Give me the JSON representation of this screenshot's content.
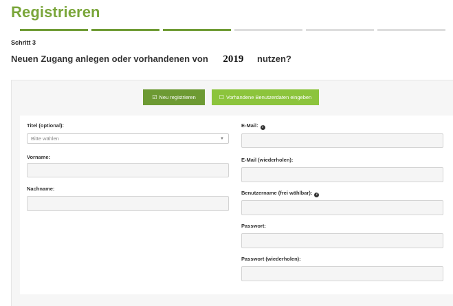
{
  "page": {
    "title": "Registrieren"
  },
  "progress": {
    "total_steps": 6,
    "completed_steps": 3
  },
  "step": {
    "label": "Schritt 3"
  },
  "question": {
    "before": "Neuen Zugang anlegen oder vorhandenen von",
    "year": "2019",
    "after": "nutzen?"
  },
  "buttons": {
    "new": {
      "icon": "checked-box-icon",
      "label": "Neu registrieren"
    },
    "existing": {
      "icon": "empty-box-icon",
      "label": "Vorhandene Benutzerdaten eingeben"
    }
  },
  "form": {
    "title": {
      "label": "Titel (optional):",
      "placeholder": "Bitte wählen"
    },
    "firstname": {
      "label": "Vorname:",
      "value": ""
    },
    "lastname": {
      "label": "Nachname:",
      "value": ""
    },
    "email": {
      "label": "E-Mail:",
      "value": ""
    },
    "email_repeat": {
      "label": "E-Mail (wiederholen):",
      "value": ""
    },
    "username": {
      "label": "Benutzername (frei wählbar):",
      "value": ""
    },
    "password": {
      "label": "Passwort:",
      "value": ""
    },
    "password_repeat": {
      "label": "Passwort (wiederholen):",
      "value": ""
    }
  },
  "colors": {
    "primary": "#6d9a33",
    "secondary": "#8cc43c",
    "title": "#7aa63a",
    "inactive_step": "#dddddd"
  }
}
